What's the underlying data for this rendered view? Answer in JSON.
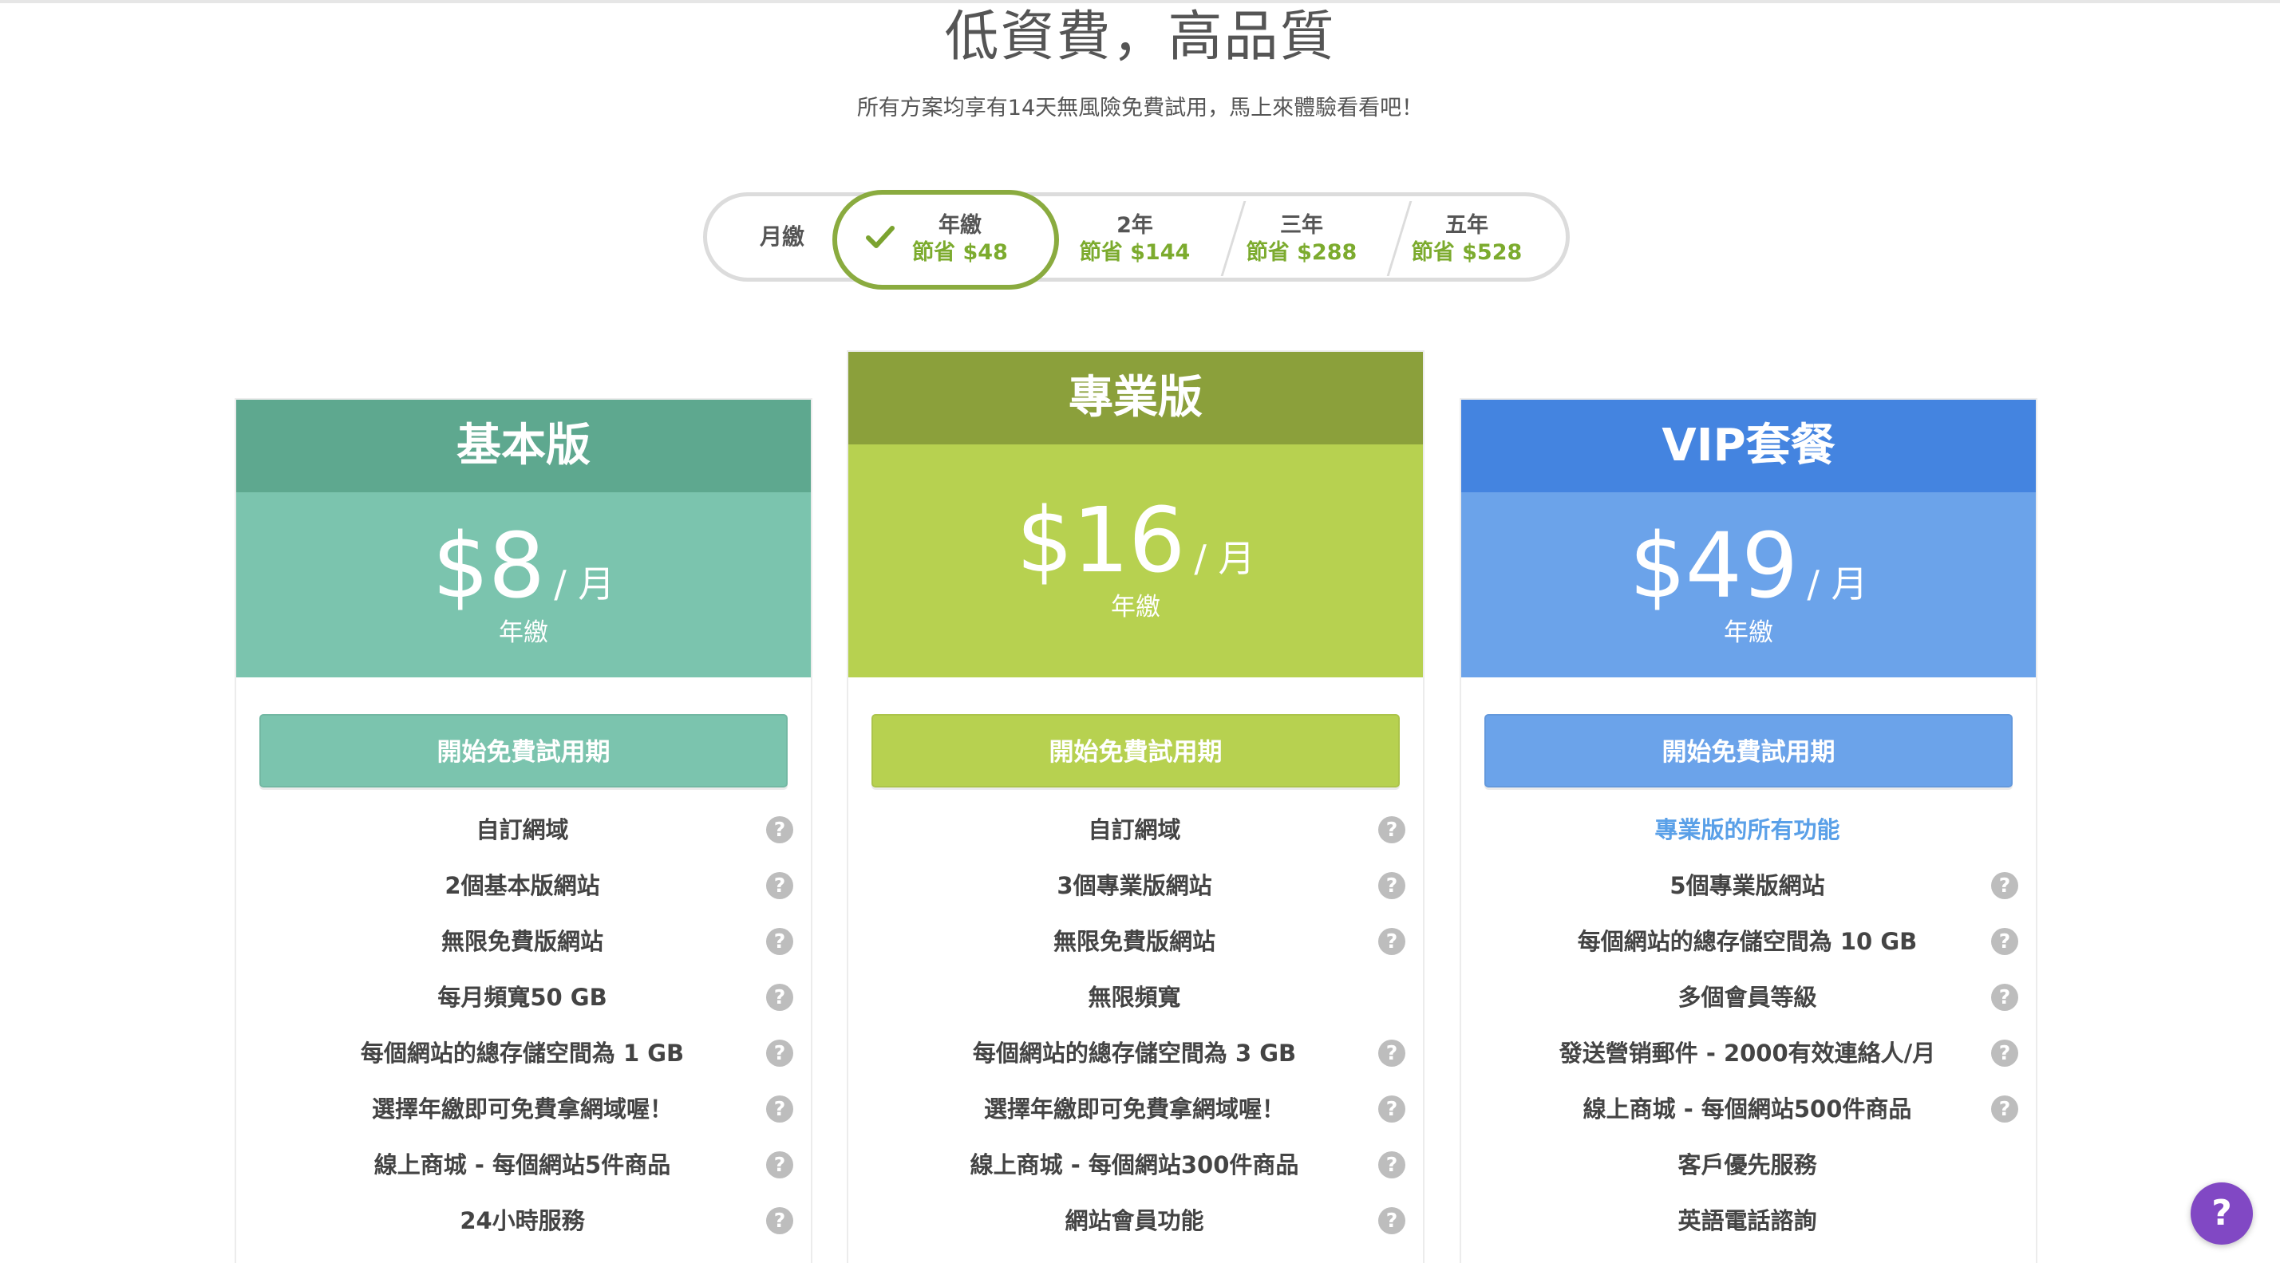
{
  "header": {
    "title": "低資費，高品質",
    "subtitle": "所有方案均享有14天無風險免費試用，馬上來體驗看看吧！"
  },
  "billing": {
    "monthly_label": "月繳",
    "options": [
      {
        "name": "年繳",
        "saving": "節省 $48",
        "selected": true
      },
      {
        "name": "2年",
        "saving": "節省 $144"
      },
      {
        "name": "三年",
        "saving": "節省 $288"
      },
      {
        "name": "五年",
        "saving": "節省 $528"
      }
    ]
  },
  "plans": [
    {
      "name": "基本版",
      "price": "$8",
      "per": "/ 月",
      "term": "年繳",
      "cta": "開始免費試用期",
      "colors": {
        "head": "#5ea88f",
        "body": "#7bc4ae",
        "button": "#7bc4ae"
      },
      "features": [
        {
          "text": "自訂網域",
          "help": true
        },
        {
          "text": "2個基本版網站",
          "help": true
        },
        {
          "text": "無限免費版網站",
          "help": true
        },
        {
          "text": "每月頻寬50 GB",
          "help": true
        },
        {
          "text": "每個網站的總存儲空間為 1 GB",
          "help": true
        },
        {
          "text": "選擇年繳即可免費拿網域喔！",
          "help": true
        },
        {
          "text": "線上商城 - 每個網站5件商品",
          "help": true
        },
        {
          "text": "24小時服務",
          "help": true
        }
      ]
    },
    {
      "name": "專業版",
      "price": "$16",
      "per": "/ 月",
      "term": "年繳",
      "cta": "開始免費試用期",
      "colors": {
        "head": "#8ba03b",
        "body": "#b7d150",
        "button": "#b7d150"
      },
      "features": [
        {
          "text": "自訂網域",
          "help": true
        },
        {
          "text": "3個專業版網站",
          "help": true
        },
        {
          "text": "無限免費版網站",
          "help": true
        },
        {
          "text": "無限頻寬",
          "help": false
        },
        {
          "text": "每個網站的總存儲空間為 3 GB",
          "help": true
        },
        {
          "text": "選擇年繳即可免費拿網域喔！",
          "help": true
        },
        {
          "text": "線上商城 - 每個網站300件商品",
          "help": true
        },
        {
          "text": "網站會員功能",
          "help": true
        }
      ]
    },
    {
      "name": "VIP套餐",
      "price": "$49",
      "per": "/ 月",
      "term": "年繳",
      "cta": "開始免費試用期",
      "colors": {
        "head": "#4484e0",
        "body": "#6ba3ea",
        "button": "#6ba3ea"
      },
      "features": [
        {
          "text": "專業版的所有功能",
          "help": false,
          "highlight": true
        },
        {
          "text": "5個專業版網站",
          "help": true
        },
        {
          "text": "每個網站的總存儲空間為 10 GB",
          "help": true
        },
        {
          "text": "多個會員等級",
          "help": true
        },
        {
          "text": "發送營销郵件 - 2000有效連絡人/月",
          "help": true
        },
        {
          "text": "線上商城 - 每個網站500件商品",
          "help": true
        },
        {
          "text": "客戶優先服務",
          "help": false
        },
        {
          "text": "英語電話諮詢",
          "help": false
        }
      ]
    }
  ],
  "help_fab": {
    "label": "?",
    "color": "#8148c4"
  }
}
